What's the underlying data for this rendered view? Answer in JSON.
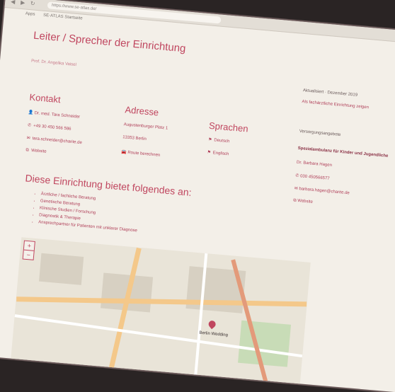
{
  "browser": {
    "url": "https://www.se-atlas.de/",
    "bookmarks": [
      "Apps",
      "SE-ATLAS Startseite"
    ]
  },
  "page": {
    "heading": "Leiter / Sprecher der Einrichtung",
    "leader": "Prof. Dr. Angelika Vaisel"
  },
  "contact": {
    "title": "Kontakt",
    "person": "Dr. med. Tara Schneider",
    "phone": "+49 30 450 566 586",
    "email": "tara.schneider@charite.de",
    "web": "Website"
  },
  "address": {
    "title": "Adresse",
    "street": "Augustenburger Platz 1",
    "city": "13353 Berlin",
    "route": "Route berechnen"
  },
  "languages": {
    "title": "Sprachen",
    "items": [
      "Deutsch",
      "Englisch"
    ]
  },
  "offers": {
    "title": "Diese Einrichtung bietet folgendes an:",
    "items": [
      "Ärztliche / fachliche Beratung",
      "Genetische Beratung",
      "Klinische Studien / Forschung",
      "Diagnostik & Therapie",
      "Ansprechpartner für Patienten mit unklarer Diagnose"
    ]
  },
  "sidebar": {
    "updated": "Aktualisiert · Dezember 2019",
    "link": "Als fachärztliche Einrichtung zeigen",
    "supply_title": "Versorgungsangebote",
    "supply_name": "Spezialambulanz für Kinder und Jugendliche",
    "supply_doctor": "Dr. Barbara Hagen",
    "supply_phone": "030 450566577",
    "supply_email": "barbara.hagen@charite.de",
    "supply_web": "Website"
  },
  "map": {
    "zoom_in": "+",
    "zoom_out": "−",
    "label": "Berlin Wedding"
  },
  "colors": {
    "accent": "#c0465f",
    "background": "#f3efe8"
  }
}
